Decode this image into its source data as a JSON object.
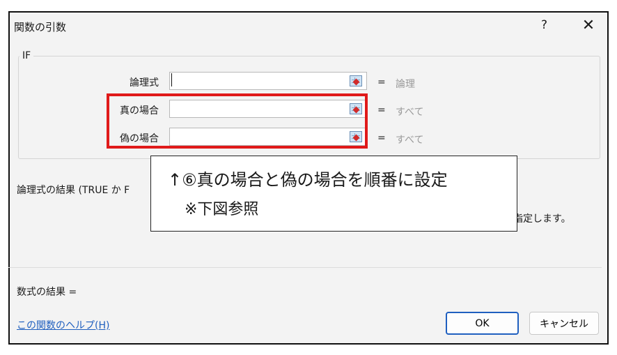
{
  "dialog": {
    "title": "関数の引数",
    "help": "?",
    "close": "✕",
    "function_name": "IF",
    "args": [
      {
        "label": "論理式",
        "value": "",
        "result": "論理"
      },
      {
        "label": "真の場合",
        "value": "",
        "result": "すべて"
      },
      {
        "label": "偽の場合",
        "value": "",
        "result": "すべて"
      }
    ],
    "equals": "=",
    "description": "論理式の結果 (TRUE か F",
    "description_tail": "指定します。",
    "formula_result": "数式の結果 =",
    "help_link": "この関数のヘルプ(H)",
    "ok": "OK",
    "cancel": "キャンセル"
  },
  "annotation": {
    "line1": "↑⑥真の場合と偽の場合を順番に設定",
    "line2": "※下図参照"
  }
}
